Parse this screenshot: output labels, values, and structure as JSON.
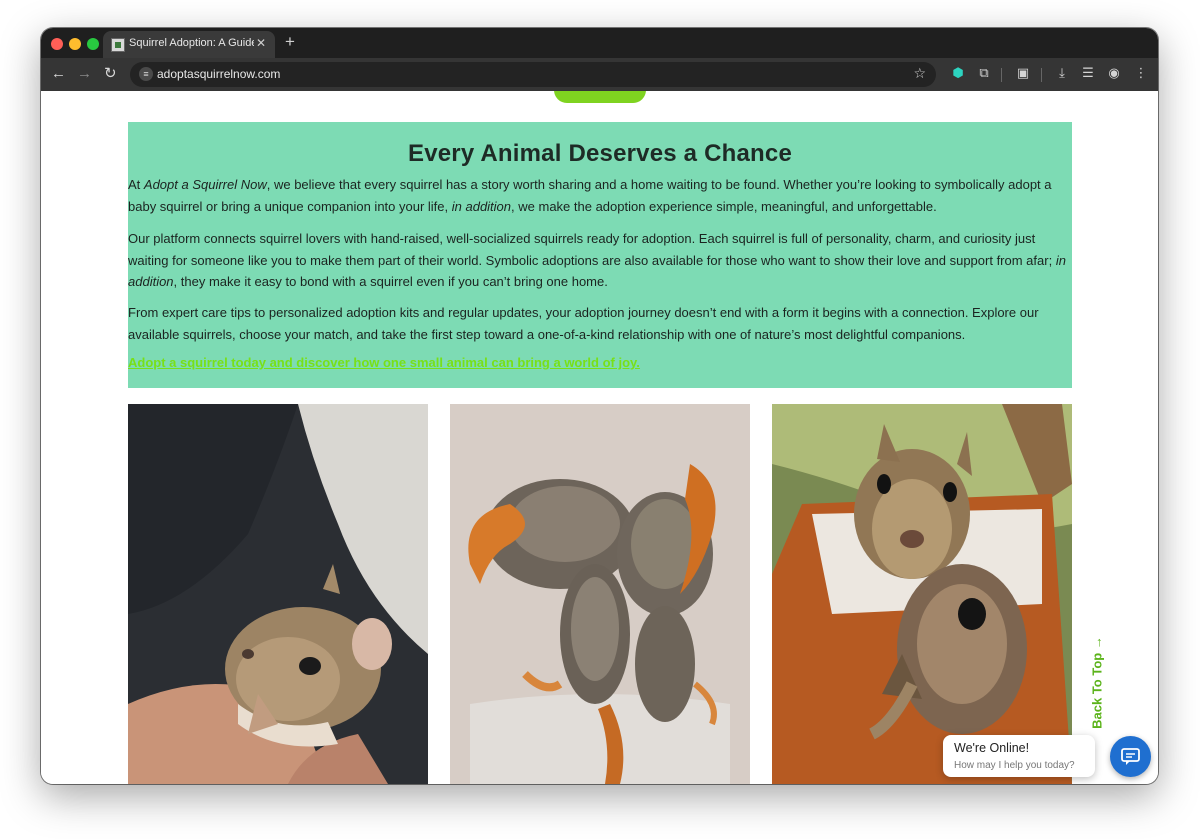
{
  "browser": {
    "tab_title": "Squirrel Adoption: A Guide to",
    "tab_close": "✕",
    "new_tab": "+",
    "url": "adoptasquirrelnow.com"
  },
  "hero": {
    "heading": "Every Animal Deserves a Chance",
    "p1_a": "At ",
    "p1_em1": "Adopt a Squirrel Now",
    "p1_b": ", we believe that every squirrel has a story worth sharing and a home waiting to be found. Whether you’re looking to symbolically adopt a baby squirrel or bring a unique companion into your life, ",
    "p1_em2": "in addition",
    "p1_c": ", we make the adoption experience simple, meaningful, and unforgettable.",
    "p2_a": "Our platform connects squirrel lovers with hand-raised, well-socialized squirrels ready for adoption. Each squirrel is full of personality, charm, and curiosity just waiting for someone like you to make them part of their world. Symbolic adoptions are also available for those who want to show their love and support from afar; ",
    "p2_em": "in addition",
    "p2_b": ", they make it easy to bond with a squirrel even if you can’t bring one home.",
    "p3": "From expert care tips to personalized adoption kits and regular updates, your adoption journey doesn’t end with a form it begins with a connection. Explore our available squirrels, choose your match, and take the first step toward a one-of-a-kind relationship with one of nature’s most delightful companions.",
    "cta": "Adopt a squirrel today and discover how one small animal can bring a world of joy."
  },
  "photos": [
    {
      "subject": "baby squirrel held in hand"
    },
    {
      "subject": "four baby squirrels sleeping on towel"
    },
    {
      "subject": "two squirrels in wooden box"
    }
  ],
  "back_to_top": "Back To Top →",
  "chat": {
    "title": "We're Online!",
    "subtitle": "How may I help you today?"
  },
  "colors": {
    "hero_bg": "#7ddbb4",
    "cta": "#78e018",
    "chat_button": "#1f6fd0"
  }
}
